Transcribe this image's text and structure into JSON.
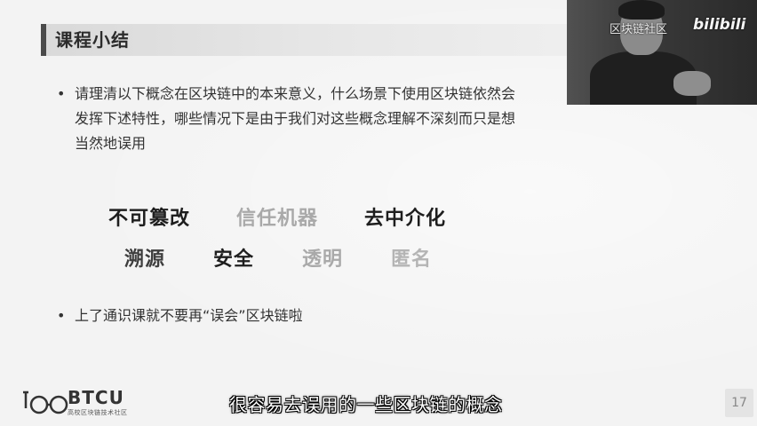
{
  "slide": {
    "title": "课程小结",
    "bullet1": "请理清以下概念在区块链中的本来意义，什么场景下使用区块链依然会发挥下述特性，哪些情况下是由于我们对这些概念理解不深刻而只是想当然地误用",
    "bullet2": "上了通识课就不要再“误会”区块链啦",
    "bullet_marker": "•",
    "keywords": [
      {
        "text": "不可篡改"
      },
      {
        "text": "信任机器"
      },
      {
        "text": "去中介化"
      },
      {
        "text": "溯源"
      },
      {
        "text": "安全"
      },
      {
        "text": "透明"
      },
      {
        "text": "匿名"
      }
    ],
    "logo_text": "BTCU",
    "logo_subtext": "高校区块链技术社区",
    "page_number": "17"
  },
  "video": {
    "watermark_text": "区块链社区",
    "watermark_logo": "bilibili"
  },
  "subtitle": "很容易去误用的一些区块链的概念"
}
